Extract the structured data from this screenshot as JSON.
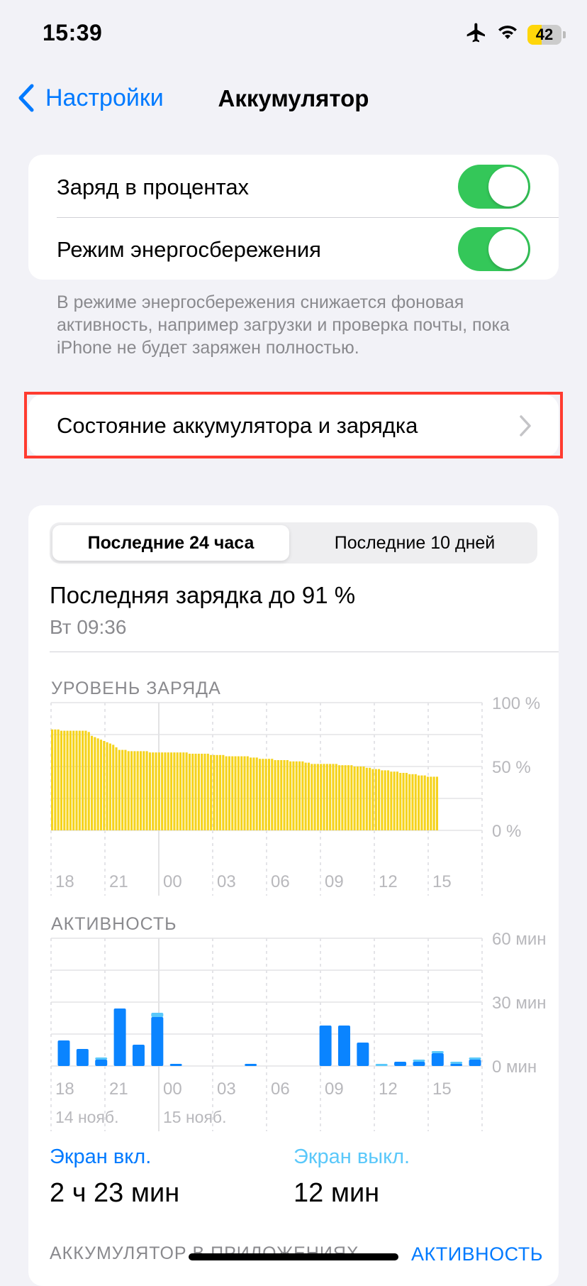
{
  "status": {
    "time": "15:39",
    "battery": "42",
    "battery_level": 42
  },
  "nav": {
    "back_label": "Настройки",
    "title": "Аккумулятор"
  },
  "settings": {
    "percent_label": "Заряд в процентах",
    "percent_on": true,
    "low_power_label": "Режим энергосбережения",
    "low_power_on": true,
    "footnote": "В режиме энергосбережения снижается фоновая активность, например загрузки и проверка почты, пока iPhone не будет заряжен полностью.",
    "health_label": "Состояние аккумулятора и зарядка"
  },
  "usage": {
    "tabs": [
      "Последние 24 часа",
      "Последние 10 дней"
    ],
    "selected_tab": 0,
    "last_charge": "Последняя зарядка до 91 %",
    "last_charge_time": "Вт 09:36",
    "level_caption": "УРОВЕНЬ ЗАРЯДА",
    "activity_caption": "АКТИВНОСТЬ",
    "screen_on_label": "Экран вкл.",
    "screen_on_value": "2 ч 23 мин",
    "screen_off_label": "Экран выкл.",
    "screen_off_value": "12 мин",
    "apps_caption": "АККУМУЛЯТОР В ПРИЛОЖЕНИЯХ",
    "apps_action": "АКТИВНОСТЬ"
  },
  "colors": {
    "accent": "#007aff",
    "toggle_on": "#34c759",
    "battery_bar": "#f5d31c",
    "screen_on": "#0a84ff",
    "screen_off": "#5ac8fa",
    "highlight": "#ff3b30"
  },
  "chart_data": [
    {
      "type": "bar",
      "title": "УРОВЕНЬ ЗАРЯДА",
      "x_ticks": [
        "18",
        "21",
        "00",
        "03",
        "06",
        "09",
        "12",
        "15"
      ],
      "y_ticks": [
        "100 %",
        "50 %",
        "0 %"
      ],
      "ylim": [
        0,
        100
      ],
      "values": [
        79,
        79,
        79,
        78,
        78,
        78,
        78,
        78,
        78,
        78,
        78,
        78,
        77,
        74,
        73,
        72,
        71,
        70,
        69,
        68,
        67,
        65,
        63,
        63,
        63,
        62,
        62,
        62,
        62,
        62,
        62,
        62,
        61,
        61,
        61,
        61,
        61,
        61,
        61,
        61,
        61,
        61,
        61,
        61,
        61,
        60,
        60,
        60,
        60,
        60,
        60,
        60,
        59,
        59,
        59,
        59,
        59,
        58,
        58,
        58,
        58,
        58,
        58,
        58,
        58,
        57,
        57,
        57,
        56,
        56,
        56,
        56,
        56,
        55,
        55,
        55,
        55,
        55,
        54,
        54,
        54,
        54,
        54,
        53,
        53,
        52,
        52,
        52,
        52,
        52,
        52,
        52,
        52,
        52,
        51,
        51,
        51,
        51,
        51,
        50,
        50,
        50,
        50,
        49,
        49,
        48,
        48,
        48,
        47,
        47,
        47,
        46,
        46,
        46,
        45,
        45,
        45,
        44,
        44,
        44,
        43,
        43,
        43,
        42,
        42,
        42,
        42
      ]
    },
    {
      "type": "bar",
      "title": "АКТИВНОСТЬ",
      "x_ticks": [
        "18",
        "21",
        "00",
        "03",
        "06",
        "09",
        "12",
        "15"
      ],
      "date_labels": [
        "14 нояб.",
        "15 нояб."
      ],
      "y_ticks": [
        "60 мин",
        "30 мин",
        "0 мин"
      ],
      "ylim": [
        0,
        60
      ],
      "series": [
        {
          "name": "Экран вкл.",
          "values": [
            12,
            8,
            3,
            27,
            10,
            23,
            1,
            0,
            0,
            0,
            1,
            0,
            0,
            0,
            19,
            19,
            11,
            0,
            2,
            2,
            6,
            1,
            3
          ]
        },
        {
          "name": "Экран выкл.",
          "values": [
            0,
            0,
            1,
            0,
            0,
            2,
            0,
            0,
            0,
            0,
            0,
            0,
            0,
            0,
            0,
            0,
            0,
            1,
            0,
            1,
            1,
            1,
            1
          ]
        }
      ]
    }
  ]
}
